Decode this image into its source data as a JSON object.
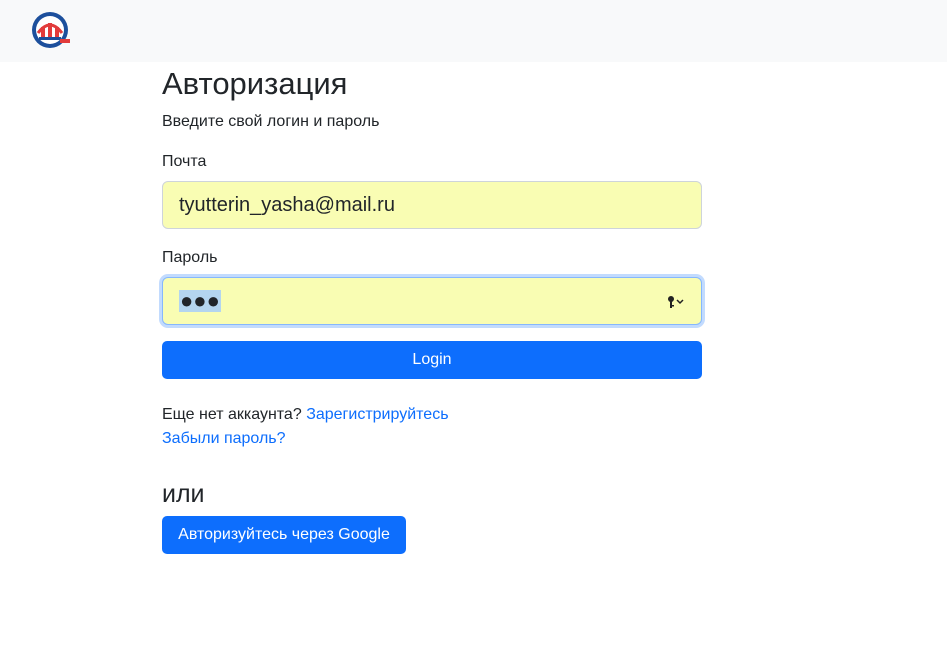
{
  "header": {
    "logo_icon": "pfr-logo-icon"
  },
  "page": {
    "title": "Авторизация",
    "subtitle": "Введите свой логин и пароль"
  },
  "form": {
    "email_label": "Почта",
    "email_value": "tyutterin_yasha@mail.ru",
    "password_label": "Пароль",
    "password_masked": "●●●",
    "password_icon": "key-dropdown-icon",
    "login_button": "Login"
  },
  "links": {
    "no_account_text": "Еще нет аккаунта?",
    "register_link": "Зарегистрируйтесь",
    "forgot_link": "Забыли пароль?"
  },
  "alt": {
    "or_text": "или",
    "google_button": "Авторизуйтесь через Google"
  },
  "colors": {
    "primary": "#0d6efd",
    "autofill_bg": "#f9fdb3",
    "navbar_bg": "#f8f9fa"
  }
}
